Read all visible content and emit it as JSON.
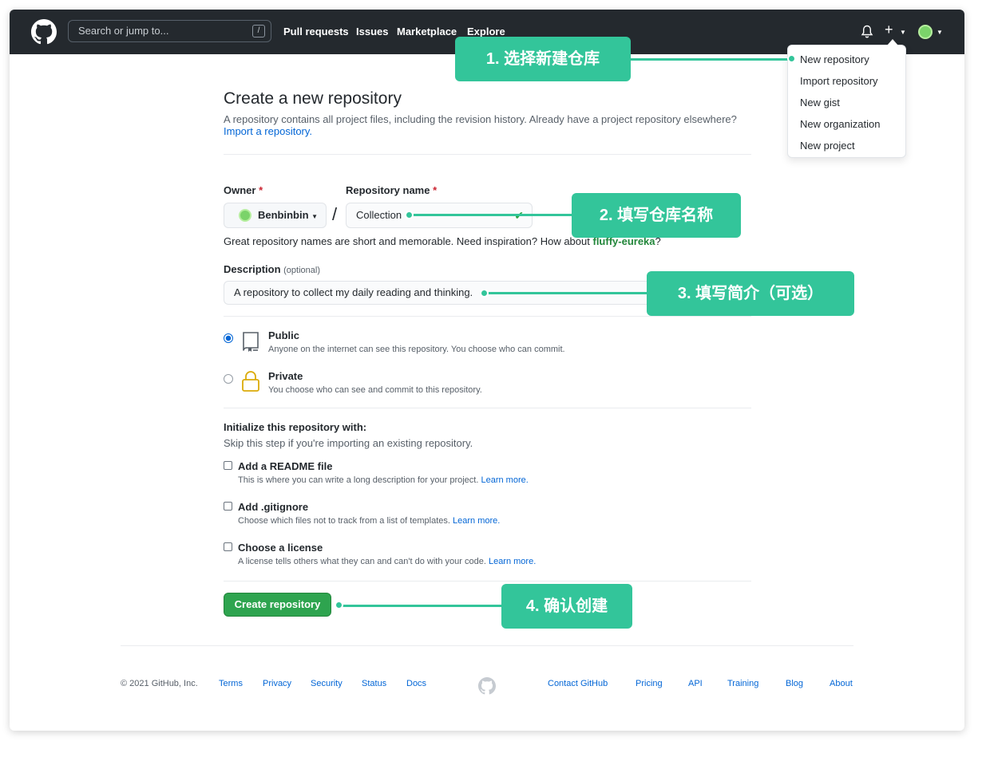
{
  "header": {
    "search_placeholder": "Search or jump to...",
    "search_shortcut": "/",
    "nav": [
      "Pull requests",
      "Issues",
      "Marketplace",
      "Explore"
    ],
    "plus": "+"
  },
  "dropdown": {
    "items": [
      "New repository",
      "Import repository",
      "New gist",
      "New organization",
      "New project"
    ]
  },
  "page": {
    "title": "Create a new repository",
    "subtitle": "A repository contains all project files, including the revision history. Already have a project repository elsewhere?",
    "import_link": "Import a repository.",
    "owner_label": "Owner",
    "required_mark": "*",
    "owner_value": "Benbinbin",
    "slash": "/",
    "repo_label": "Repository name",
    "repo_value": "Collection",
    "hint_prefix": "Great repository names are short and memorable. Need inspiration? How about",
    "hint_suggestion": "fluffy-eureka",
    "hint_suffix": "?",
    "desc_label": "Description",
    "desc_optional": "(optional)",
    "desc_value": "A repository to collect my daily reading and thinking.",
    "public_title": "Public",
    "public_desc": "Anyone on the internet can see this repository. You choose who can commit.",
    "private_title": "Private",
    "private_desc": "You choose who can see and commit to this repository.",
    "visibility_selected": "Public",
    "init_title": "Initialize this repository with:",
    "init_sub": "Skip this step if you're importing an existing repository.",
    "readme_title": "Add a README file",
    "readme_desc": "This is where you can write a long description for your project.",
    "gitignore_title": "Add .gitignore",
    "gitignore_desc": "Choose which files not to track from a list of templates.",
    "license_title": "Choose a license",
    "license_desc": "A license tells others what they can and can't do with your code.",
    "learn_more": "Learn more.",
    "create_button": "Create repository"
  },
  "footer": {
    "copyright": "© 2021 GitHub, Inc.",
    "left_links": [
      "Terms",
      "Privacy",
      "Security",
      "Status",
      "Docs"
    ],
    "right_links": [
      "Contact GitHub",
      "Pricing",
      "API",
      "Training",
      "Blog",
      "About"
    ]
  },
  "callouts": {
    "step1": "1. 选择新建仓库",
    "step2": "2. 填写仓库名称",
    "step3": "3. 填写简介（可选）",
    "step4": "4. 确认创建"
  },
  "colors": {
    "header_bg": "#24292e",
    "callout": "#33c59a",
    "primary_button": "#2ea44f",
    "link": "#0366d6"
  }
}
